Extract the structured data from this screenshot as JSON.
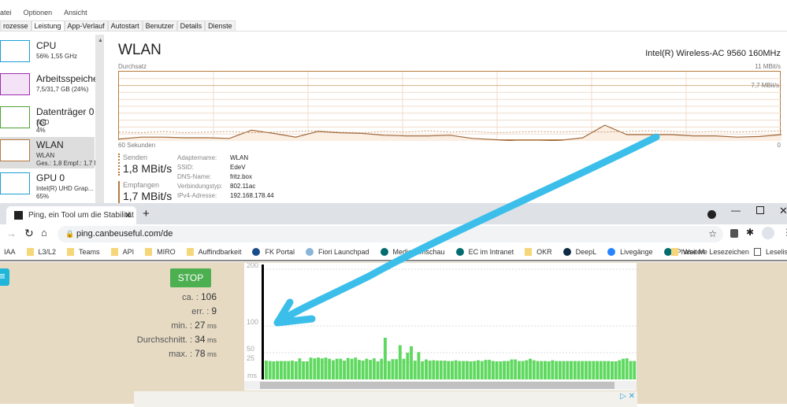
{
  "taskmanager": {
    "menu": [
      "atei",
      "Optionen",
      "Ansicht"
    ],
    "tabs": [
      "rozesse",
      "Leistung",
      "App-Verlauf",
      "Autostart",
      "Benutzer",
      "Details",
      "Dienste"
    ],
    "active_tab": "Leistung",
    "sidebar": [
      {
        "title": "CPU",
        "sub": "56% 1,55 GHz",
        "color": "#1a9fd6"
      },
      {
        "title": "Arbeitsspeicher",
        "sub": "7,5/31,7 GB (24%)",
        "color": "#9b2fae"
      },
      {
        "title": "Datenträger 0 (C",
        "sub": "SSD",
        "sub2": "4%",
        "color": "#4da32f"
      },
      {
        "title": "WLAN",
        "sub": "WLAN",
        "sub2": "Ges.: 1,8 Empf.: 1,7 M",
        "color": "#b67a3e"
      },
      {
        "title": "GPU 0",
        "sub": "Intel(R) UHD Grap...",
        "sub2": "65%",
        "color": "#1a9fd6"
      }
    ],
    "panel": {
      "title": "WLAN",
      "device": "Intel(R) Wireless-AC 9560 160MHz",
      "graph_label": "Durchsatz",
      "max_label": "11 MBit/s",
      "mid_label": "7,7 MBit/s",
      "time_label": "60 Sekunden",
      "zero_label": "0",
      "send_label": "Senden",
      "send_value": "1,8 MBit/s",
      "recv_label": "Empfangen",
      "recv_value": "1,7 MBit/s",
      "details": [
        {
          "k": "Adaptername:",
          "v": "WLAN"
        },
        {
          "k": "SSID:",
          "v": "EdeV"
        },
        {
          "k": "DNS-Name:",
          "v": "fritz.box"
        },
        {
          "k": "Verbindungstyp:",
          "v": "802.11ac"
        },
        {
          "k": "IPv4-Adresse:",
          "v": "192.168.178.44"
        }
      ],
      "send_series": [
        1.4,
        1.3,
        1.5,
        1.3,
        1.4,
        1.5,
        1.3,
        1.4,
        1.5,
        1.6,
        1.4,
        1.3,
        1.5,
        1.4,
        1.6,
        1.4,
        1.5,
        1.3,
        1.4,
        1.5,
        1.4,
        1.5,
        1.4,
        1.5,
        1.6,
        1.5,
        1.4,
        1.5,
        1.4,
        1.5,
        1.6
      ],
      "recv_series": [
        0.3,
        0.6,
        0.6,
        0.5,
        0.5,
        0.4,
        1.7,
        1.2,
        0.6,
        1.5,
        1.3,
        1.2,
        0.9,
        0.8,
        0.8,
        0.9,
        0.4,
        0.2,
        0.0,
        0.0,
        0.1,
        0.5,
        2.5,
        1.0,
        1.0,
        1.0,
        0.8,
        0.8,
        0.6,
        0.7,
        1.0
      ]
    }
  },
  "browser": {
    "tab_title": "Ping, ein Tool um die Stabilität Ih",
    "url": "ping.canbeuseful.com/de",
    "bookmarks": [
      {
        "label": "IAA",
        "icon": "none"
      },
      {
        "label": "L3/L2",
        "icon": "folder"
      },
      {
        "label": "Teams",
        "icon": "folder"
      },
      {
        "label": "API",
        "icon": "folder"
      },
      {
        "label": "MIRO",
        "icon": "folder"
      },
      {
        "label": "Auffindbarkeit",
        "icon": "folder"
      },
      {
        "label": "FK Portal",
        "icon": "sap"
      },
      {
        "label": "Fiori Launchpad",
        "icon": "page"
      },
      {
        "label": "Medienumschau",
        "icon": "sharepoint"
      },
      {
        "label": "EC im Intranet",
        "icon": "sharepoint"
      },
      {
        "label": "OKR",
        "icon": "folder"
      },
      {
        "label": "DeepL",
        "icon": "deepl"
      },
      {
        "label": "Livegänge",
        "icon": "confluence"
      },
      {
        "label": "Phase M",
        "icon": "sharepoint"
      }
    ],
    "other_bookmarks": "Weitere Lesezeichen",
    "reading_list": "Leseliste"
  },
  "ping": {
    "stop_label": "STOP",
    "stats": [
      {
        "label": "ca. : ",
        "value": "106",
        "unit": ""
      },
      {
        "label": "err. : ",
        "value": "9",
        "unit": ""
      },
      {
        "label": "min. : ",
        "value": "27",
        "unit": " ms"
      },
      {
        "label": "Durchschnitt. : ",
        "value": "34",
        "unit": " ms"
      },
      {
        "label": "max. : ",
        "value": "78",
        "unit": " ms"
      }
    ]
  },
  "chart_data": {
    "type": "bar",
    "ylabel": "ms",
    "yticks": [
      25,
      50,
      100,
      200
    ],
    "ylim": [
      0,
      200
    ],
    "grid": true,
    "bar_color": "#5fd85f",
    "values": [
      29,
      28,
      27,
      28,
      28,
      28,
      28,
      29,
      27,
      35,
      27,
      27,
      37,
      35,
      37,
      35,
      37,
      34,
      30,
      34,
      34,
      29,
      36,
      34,
      37,
      31,
      29,
      34,
      31,
      35,
      27,
      34,
      78,
      28,
      33,
      33,
      64,
      34,
      50,
      62,
      29,
      51,
      27,
      32,
      29,
      30,
      29,
      29,
      29,
      28,
      28,
      30,
      28,
      28,
      28,
      27,
      28,
      30,
      28,
      31,
      31,
      28,
      27,
      27,
      28,
      28,
      32,
      32,
      28,
      28,
      30,
      34,
      30,
      28,
      28,
      28,
      27,
      30,
      28,
      28,
      28,
      28,
      28,
      28,
      28,
      28,
      28,
      28,
      28,
      28,
      28,
      28,
      28,
      27,
      27,
      30,
      34,
      35,
      28,
      28
    ]
  },
  "annotation_color": "#3bbfea"
}
